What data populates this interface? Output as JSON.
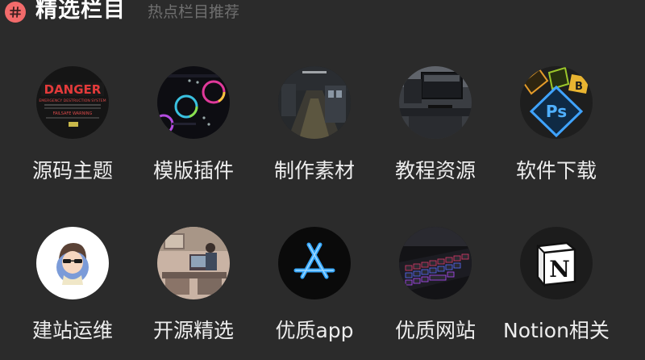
{
  "header": {
    "title": "精选栏目",
    "subtitle": "热点栏目推荐",
    "icon": "hashtag-icon",
    "icon_color": "#f26b6b"
  },
  "items": [
    {
      "label": "源码主题",
      "icon": "danger-sign-thumbnail"
    },
    {
      "label": "模版插件",
      "icon": "color-wheel-panel-thumbnail"
    },
    {
      "label": "制作素材",
      "icon": "subway-platform-thumbnail"
    },
    {
      "label": "教程资源",
      "icon": "monitor-desk-thumbnail"
    },
    {
      "label": "软件下载",
      "icon": "adobe-apps-thumbnail"
    },
    {
      "label": "建站运维",
      "icon": "avatar-sunglasses-thumbnail"
    },
    {
      "label": "开源精选",
      "icon": "cozy-room-illustration-thumbnail"
    },
    {
      "label": "优质app",
      "icon": "app-store-neon-icon"
    },
    {
      "label": "优质网站",
      "icon": "rgb-keyboard-thumbnail"
    },
    {
      "label": "Notion相关",
      "icon": "notion-logo-icon"
    }
  ],
  "thumb_texts": {
    "danger_word": "DANGER",
    "danger_line1": "EMERGENCY DESTRUCTION SYSTEM",
    "danger_line2": "FAILSAFE   WARNING",
    "ps": "Ps",
    "b": "B",
    "notion": "N"
  }
}
